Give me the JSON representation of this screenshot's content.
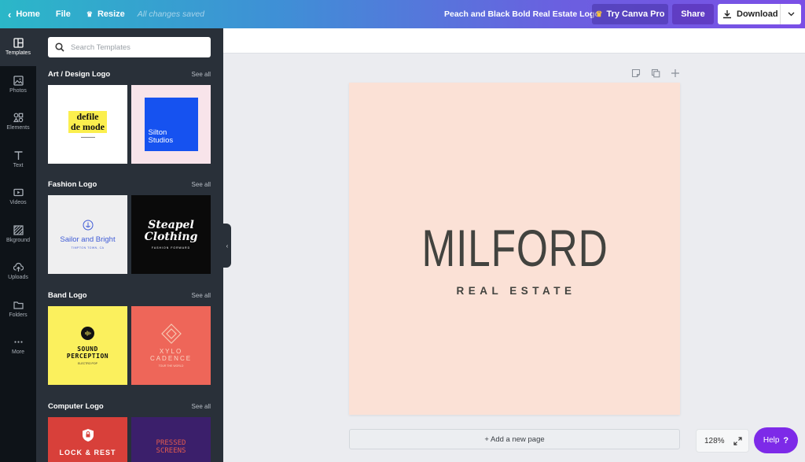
{
  "topbar": {
    "home_label": "Home",
    "file_label": "File",
    "resize_label": "Resize",
    "saved_status": "All changes saved",
    "document_title": "Peach and Black Bold Real Estate Logo",
    "pro_label": "Try Canva Pro",
    "share_label": "Share",
    "download_label": "Download"
  },
  "rail": {
    "items": [
      {
        "label": "Templates",
        "icon": "templates-icon",
        "active": true
      },
      {
        "label": "Photos",
        "icon": "photos-icon"
      },
      {
        "label": "Elements",
        "icon": "elements-icon"
      },
      {
        "label": "Text",
        "icon": "text-icon"
      },
      {
        "label": "Videos",
        "icon": "videos-icon"
      },
      {
        "label": "Bkground",
        "icon": "background-icon"
      },
      {
        "label": "Uploads",
        "icon": "uploads-icon"
      },
      {
        "label": "Folders",
        "icon": "folders-icon"
      },
      {
        "label": "More",
        "icon": "more-icon"
      }
    ]
  },
  "panel": {
    "search_placeholder": "Search Templates",
    "sections": [
      {
        "title": "Art / Design Logo",
        "see_all": "See all",
        "templates": [
          {
            "line1": "defile",
            "line2": "de mode",
            "bg": "#ffffff"
          },
          {
            "line1": "Silton",
            "line2": "Studios",
            "bg": "#f8e4ea",
            "accent": "#1652f0"
          }
        ]
      },
      {
        "title": "Fashion Logo",
        "see_all": "See all",
        "templates": [
          {
            "line1": "Sailor and Bright",
            "line2": "TIMPTON TOWN, CA",
            "bg": "#efeff0",
            "accent": "#3f5bd6"
          },
          {
            "line1": "Steapel",
            "line2": "Clothing",
            "line3": "FASHION FORWARD",
            "bg": "#0a0a0a"
          }
        ]
      },
      {
        "title": "Band Logo",
        "see_all": "See all",
        "templates": [
          {
            "line1": "SOUND",
            "line2": "PERCEPTION",
            "line3": "ELECTRO POP",
            "bg": "#fbf05d"
          },
          {
            "line1": "XYLO",
            "line2": "CADENCE",
            "line3": "TOUR THE WORLD",
            "bg": "#ee6659"
          }
        ]
      },
      {
        "title": "Computer Logo",
        "see_all": "See all",
        "templates": [
          {
            "line1": "LOCK & REST",
            "bg": "#d8403a"
          },
          {
            "line1": "PRESSED",
            "line2": "SCREENS",
            "bg": "#3b1f6b"
          }
        ]
      }
    ]
  },
  "canvas": {
    "title": "MILFORD",
    "subtitle": "REAL ESTATE",
    "background": "#fbe1d6",
    "add_page_label": "+ Add a new page",
    "zoom": "128%"
  },
  "help_label": "Help"
}
